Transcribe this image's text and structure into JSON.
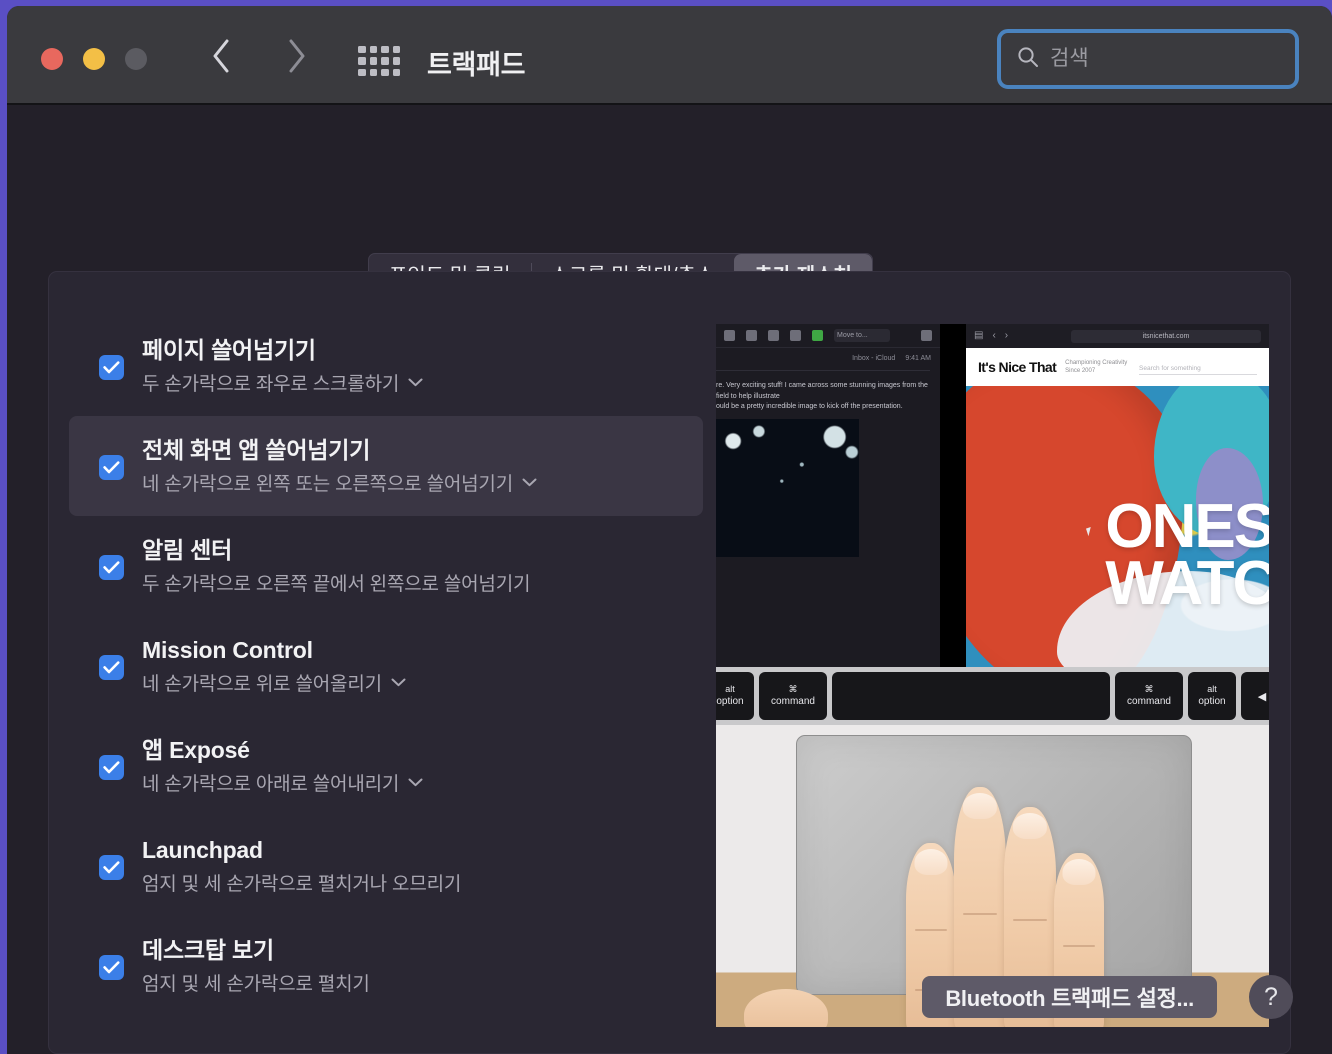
{
  "window": {
    "title": "트랙패드",
    "traffic_lights": [
      "close",
      "minimize",
      "zoom"
    ],
    "colors": {
      "close": "#e8685e",
      "minimize": "#f3bf46",
      "zoom": "#5b5b61",
      "accent": "#3b7fe8",
      "focus_ring": "#4a83bf"
    }
  },
  "toolbar": {
    "back_icon": "chevron-left-icon",
    "forward_icon": "chevron-right-icon",
    "grid_icon": "show-all-grid-icon",
    "search": {
      "icon": "search-icon",
      "placeholder": "검색",
      "value": ""
    }
  },
  "tabs": [
    {
      "label": "포인트 및 클릭",
      "active": false
    },
    {
      "label": "스크롤 및 확대/축소",
      "active": false
    },
    {
      "label": "추가 제스처",
      "active": true
    }
  ],
  "gestures": [
    {
      "title": "페이지 쓸어넘기기",
      "subtitle": "두 손가락으로 좌우로 스크롤하기",
      "checked": true,
      "has_dropdown": true,
      "highlighted": false
    },
    {
      "title": "전체 화면 앱 쓸어넘기기",
      "subtitle": "네 손가락으로 왼쪽 또는 오른쪽으로 쓸어넘기기",
      "checked": true,
      "has_dropdown": true,
      "highlighted": true
    },
    {
      "title": "알림 센터",
      "subtitle": "두 손가락으로 오른쪽 끝에서 왼쪽으로 쓸어넘기기",
      "checked": true,
      "has_dropdown": false,
      "highlighted": false
    },
    {
      "title": "Mission Control",
      "subtitle": "네 손가락으로 위로 쓸어올리기",
      "checked": true,
      "has_dropdown": true,
      "highlighted": false
    },
    {
      "title": "앱 Exposé",
      "subtitle": "네 손가락으로 아래로 쓸어내리기",
      "checked": true,
      "has_dropdown": true,
      "highlighted": false
    },
    {
      "title": "Launchpad",
      "subtitle": "엄지 및 세 손가락으로 펼치거나 오므리기",
      "checked": true,
      "has_dropdown": false,
      "highlighted": false
    },
    {
      "title": "데스크탑 보기",
      "subtitle": "엄지 및 세 손가락으로 펼치기",
      "checked": true,
      "has_dropdown": false,
      "highlighted": false
    }
  ],
  "preview": {
    "mail": {
      "meta_folder": "Inbox - iCloud",
      "meta_time": "9:41 AM",
      "body_line1": "re. Very exciting stuff! I came across some stunning images from the field to help illustrate",
      "body_line2": "ould be a pretty incredible image to kick off the presentation.",
      "move_to_label": "Move to..."
    },
    "safari": {
      "url": "itsnicethat.com",
      "site_logo": "It's Nice That",
      "tagline_line1": "Championing Creativity",
      "tagline_line2": "Since 2007",
      "search_placeholder": "Search for something",
      "hero_line1": "ONES",
      "hero_line2": "WATC"
    },
    "keyboard": {
      "alt_top": "alt",
      "alt_bottom": "option",
      "cmd_top": "⌘",
      "cmd_bottom": "command",
      "arrow": "◀"
    }
  },
  "footer": {
    "bluetooth_button": "Bluetooth 트랙패드 설정...",
    "help_button": "?"
  }
}
